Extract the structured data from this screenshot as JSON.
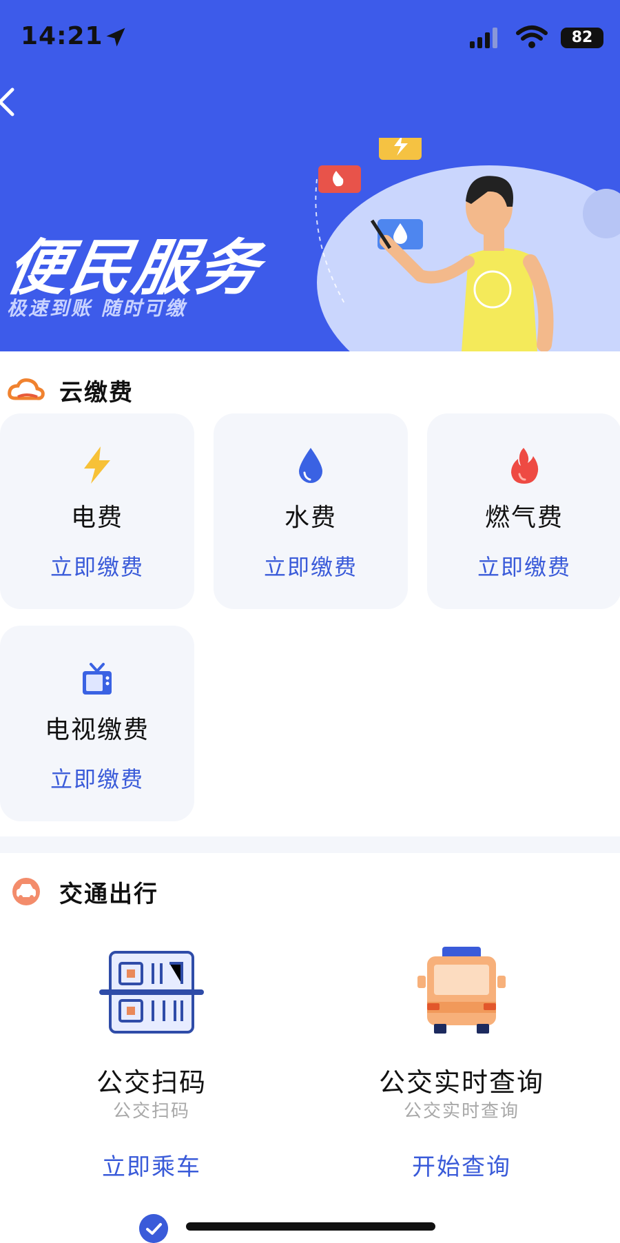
{
  "status_bar": {
    "time": "14:21",
    "battery": "82"
  },
  "banner": {
    "title": "便民服务",
    "subtitle": "极速到账  随时可缴"
  },
  "cloud_pay": {
    "title": "云缴费",
    "items": [
      {
        "name": "电费",
        "action": "立即缴费",
        "icon": "lightning-icon"
      },
      {
        "name": "水费",
        "action": "立即缴费",
        "icon": "water-drop-icon"
      },
      {
        "name": "燃气费",
        "action": "立即缴费",
        "icon": "flame-icon"
      },
      {
        "name": "电视缴费",
        "action": "立即缴费",
        "icon": "tv-icon"
      }
    ]
  },
  "transport": {
    "title": "交通出行",
    "items": [
      {
        "name": "公交扫码",
        "subtitle": "公交扫码",
        "action": "立即乘车",
        "icon": "qr-scan-icon"
      },
      {
        "name": "公交实时查询",
        "subtitle": "公交实时查询",
        "action": "开始查询",
        "icon": "bus-icon"
      }
    ]
  },
  "colors": {
    "brand_blue": "#3d5bea",
    "link_blue": "#3a5bd9",
    "card_bg": "#f4f6fb"
  }
}
